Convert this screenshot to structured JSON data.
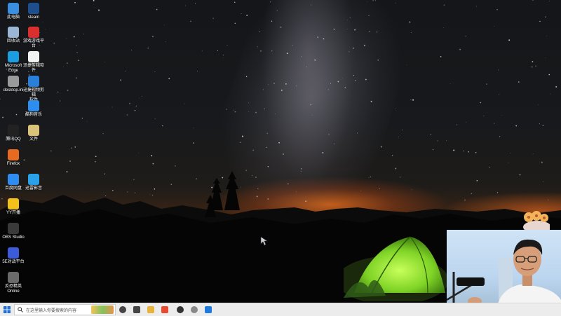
{
  "desktop": {
    "icons": [
      {
        "label": "此电脑",
        "icon": "this-pc-icon",
        "color": "#3a8fe0"
      },
      {
        "label": "steam",
        "icon": "steam-icon",
        "color": "#1f4e8c"
      },
      {
        "label": "回收站",
        "icon": "recycle-bin-icon",
        "color": "#9bb7d6"
      },
      {
        "label": "游戏游戏平台",
        "icon": "game-platform-icon",
        "color": "#d92f2f"
      },
      {
        "label": "Microsoft\nEdge",
        "icon": "edge-icon",
        "color": "#1b9de2"
      },
      {
        "label": "迅捷剪辑软件",
        "icon": "document-icon",
        "color": "#f2f2f2"
      },
      {
        "label": "desktop.ini",
        "icon": "ini-file-icon",
        "color": "#9a9a9a"
      },
      {
        "label": "迅捷视频剪辑\n软件",
        "icon": "video-editor-icon",
        "color": "#2a7fd6"
      },
      {
        "label": "酷狗音乐",
        "icon": "kugou-music-icon",
        "color": "#2e8ef0"
      },
      {
        "label": "腾讯QQ",
        "icon": "qq-icon",
        "color": "#222222"
      },
      {
        "label": "文件",
        "icon": "file-icon",
        "color": "#d9c27a"
      },
      {
        "label": "Firefox",
        "icon": "firefox-icon",
        "color": "#e66a1f"
      },
      {
        "label": "百度网盘",
        "icon": "baidu-netdisk-icon",
        "color": "#2f8df2"
      },
      {
        "label": "迅雷影音",
        "icon": "xunlei-player-icon",
        "color": "#2aa1e8"
      },
      {
        "label": "YY开播",
        "icon": "yy-icon",
        "color": "#f2c21b"
      },
      {
        "label": "OBS Studio",
        "icon": "obs-icon",
        "color": "#3a3a3a"
      },
      {
        "label": "5E对战平台",
        "icon": "5e-platform-icon",
        "color": "#3b5bdb"
      },
      {
        "label": "反恐精英\nOnline",
        "icon": "csol-icon",
        "color": "#6a6a6a"
      }
    ]
  },
  "taskbar": {
    "start_icon": "windows-start-icon",
    "search_placeholder": "在这里输入你要搜索的内容",
    "apps": [
      {
        "icon": "cortana-icon",
        "color": "#444444"
      },
      {
        "icon": "task-view-icon",
        "color": "#444444"
      },
      {
        "icon": "file-explorer-icon",
        "color": "#e8b33a"
      },
      {
        "icon": "browser-icon",
        "color": "#e84a2f"
      },
      {
        "icon": "obs-taskbar-icon",
        "color": "#333333"
      },
      {
        "icon": "settings-icon",
        "color": "#888888"
      },
      {
        "icon": "video-editor-taskbar-icon",
        "color": "#1f7ae0"
      }
    ]
  },
  "overlay": {
    "webcam": "webcam-overlay",
    "mascot": "mascot-sticker"
  }
}
